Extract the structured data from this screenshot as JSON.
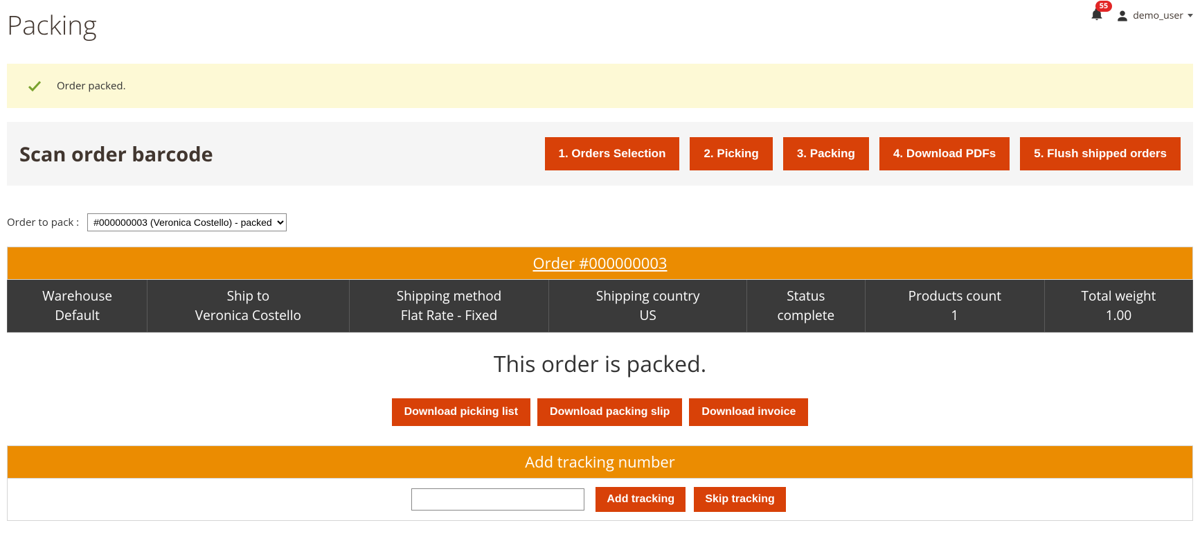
{
  "header": {
    "title": "Packing",
    "notification_count": "55",
    "username": "demo_user"
  },
  "message": {
    "text": "Order packed."
  },
  "barcode_panel": {
    "title": "Scan order barcode",
    "steps": [
      "1. Orders Selection",
      "2. Picking",
      "3. Packing",
      "4. Download PDFs",
      "5. Flush shipped orders"
    ]
  },
  "order_select": {
    "label": "Order to pack :",
    "selected": "#000000003 (Veronica Costello) - packed"
  },
  "order": {
    "header_link": "Order #000000003",
    "cols": [
      {
        "label": "Warehouse",
        "value": "Default"
      },
      {
        "label": "Ship to",
        "value": "Veronica Costello"
      },
      {
        "label": "Shipping method",
        "value": "Flat Rate - Fixed"
      },
      {
        "label": "Shipping country",
        "value": "US"
      },
      {
        "label": "Status",
        "value": "complete"
      },
      {
        "label": "Products count",
        "value": "1"
      },
      {
        "label": "Total weight",
        "value": "1.00"
      }
    ]
  },
  "packed_message": "This order is packed.",
  "downloads": {
    "picking_list": "Download picking list",
    "packing_slip": "Download packing slip",
    "invoice": "Download invoice"
  },
  "tracking": {
    "header": "Add tracking number",
    "add_label": "Add tracking",
    "skip_label": "Skip tracking"
  }
}
